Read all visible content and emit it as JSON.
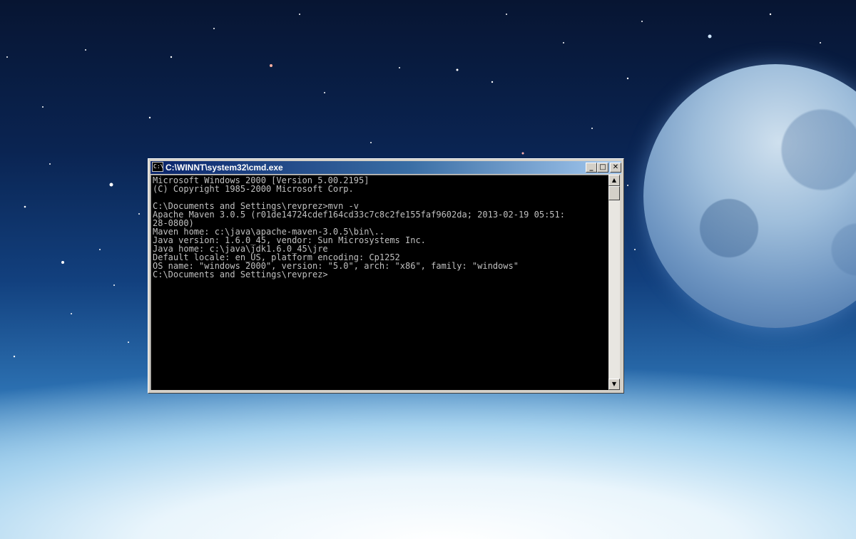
{
  "window": {
    "title": "C:\\WINNT\\system32\\cmd.exe",
    "icon_name": "console-app-icon",
    "icon_glyph": "C:\\",
    "buttons": {
      "minimize": "_",
      "maximize": "□",
      "close": "✕"
    }
  },
  "console": {
    "lines": [
      "Microsoft Windows 2000 [Version 5.00.2195]",
      "(C) Copyright 1985-2000 Microsoft Corp.",
      "",
      "C:\\Documents and Settings\\revprez>mvn -v",
      "Apache Maven 3.0.5 (r01de14724cdef164cd33c7c8c2fe155faf9602da; 2013-02-19 05:51:",
      "28-0800)",
      "Maven home: c:\\java\\apache-maven-3.0.5\\bin\\..",
      "Java version: 1.6.0_45, vendor: Sun Microsystems Inc.",
      "Java home: c:\\java\\jdk1.6.0_45\\jre",
      "Default locale: en_US, platform encoding: Cp1252",
      "OS name: \"windows 2000\", version: \"5.0\", arch: \"x86\", family: \"windows\"",
      "C:\\Documents and Settings\\revprez>"
    ],
    "text_color": "#c0c0c0",
    "background_color": "#000000"
  },
  "scrollbar": {
    "up_arrow": "▲",
    "down_arrow": "▼"
  },
  "colors": {
    "titlebar_start": "#0a246a",
    "titlebar_end": "#a6caf0",
    "window_face": "#d4d0c8"
  }
}
